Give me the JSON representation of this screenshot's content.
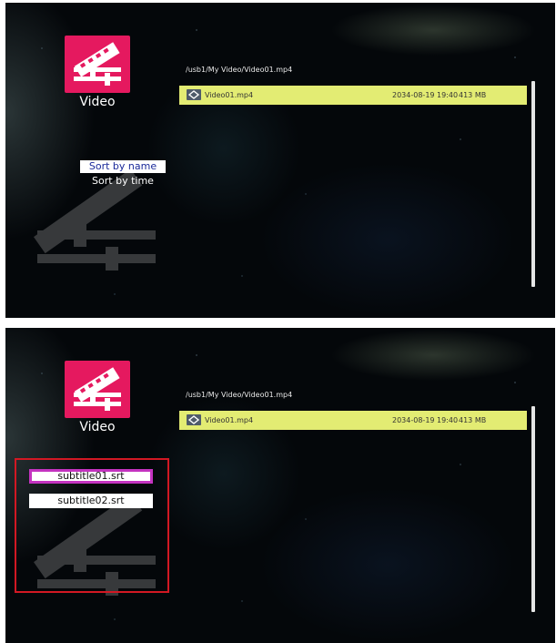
{
  "screens": [
    {
      "header": {
        "category_label": "Video"
      },
      "path": "/usb1/My Video/Video01.mp4",
      "files": [
        {
          "name": "Video01.mp4",
          "date": "2034-08-19 19:40",
          "size": "413 MB"
        }
      ],
      "sort_menu": {
        "items": [
          "Sort by name",
          "Sort by time"
        ],
        "selected": "Sort by name"
      }
    },
    {
      "header": {
        "category_label": "Video"
      },
      "path": "/usb1/My Video/Video01.mp4",
      "files": [
        {
          "name": "Video01.mp4",
          "date": "2034-08-19 19:40",
          "size": "413 MB"
        }
      ],
      "subtitle_menu": {
        "items": [
          "subtitle01.srt",
          "subtitle02.srt"
        ],
        "selected": "subtitle01.srt"
      }
    }
  ],
  "colors": {
    "category_icon_bg": "#e5195f",
    "selected_row_bg": "#e3ec73",
    "selected_sort_text": "#1a2a9a",
    "highlight_box_border": "#d21823",
    "focused_item_border": "#c433c0"
  },
  "icons": [
    "film-reel-icon",
    "file-video-icon"
  ]
}
